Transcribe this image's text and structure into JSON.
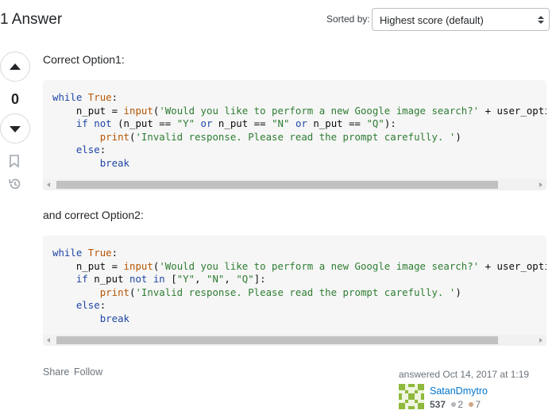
{
  "header": {
    "title": "1 Answer",
    "sort_label": "Sorted by:",
    "sort_value": "Highest score (default)"
  },
  "answer": {
    "score": "0",
    "intro1": "Correct Option1:",
    "intro2": "and correct Option2:",
    "code1": [
      "while True:",
      "    n_put = input('Would you like to perform a new Google image search?' + user_optio",
      "    if not (n_put == \"Y\" or n_put == \"N\" or n_put == \"Q\"):",
      "        print('Invalid response. Please read the prompt carefully. ')",
      "    else:",
      "        break"
    ],
    "code2": [
      "while True:",
      "    n_put = input('Would you like to perform a new Google image search?' + user_optio",
      "    if n_put not in [\"Y\", \"N\", \"Q\"]:",
      "        print('Invalid response. Please read the prompt carefully. ')",
      "    else:",
      "        break"
    ],
    "menu": {
      "share": "Share",
      "follow": "Follow"
    },
    "answered_text": "answered Oct 14, 2017 at 1:19",
    "user": {
      "name": "SatanDmytro",
      "reputation": "537",
      "silver": "2",
      "bronze": "7"
    }
  },
  "colors": {
    "accent_link": "#0074cc",
    "keyword": "#1f47a5",
    "builtin": "#b75501",
    "string": "#2e7d32",
    "avatar_green": "#8fb93c"
  }
}
